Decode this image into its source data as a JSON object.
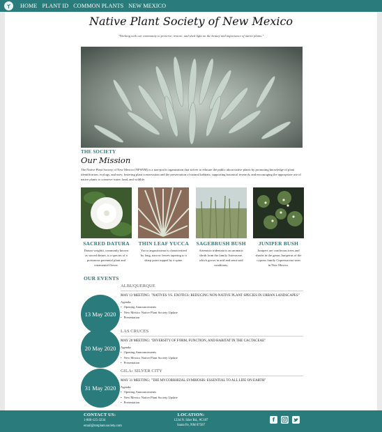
{
  "nav": {
    "items": [
      "HOME",
      "PLANT ID",
      "COMMON PLANTS",
      "NEW MEXICO"
    ]
  },
  "site": {
    "title": "Native Plant Society of New Mexico",
    "tagline": "\"Working with our community to preserve, restore, and shed light on the beauty and importance of native plants.\""
  },
  "society": {
    "kicker": "THE SOCIETY",
    "title": "Our Mission",
    "mission": "The Native Plant Society of New Mexico (NPSNM) is a non-profit organization that strives to educate the public about native plants by promoting knowledge of plant identification, ecology, and uses; fostering plant conservation and the preservation of natural habitats; supporting botanical research; and encouraging the appropriate use of native plants to conserve water, land, and wildlife."
  },
  "plants": [
    {
      "name": "SACRED DATURA",
      "desc": "Datura wrightii, commonly known as sacred datura, is a species of a poisonous perennial plant and ornamental flower."
    },
    {
      "name": "THIN LEAF YUCCA",
      "desc": "Yucca angustissima is characterized by long, narrow leaves tapering to a sharp point topped by a spine."
    },
    {
      "name": "SAGEBRUSH BUSH",
      "desc": "Artemisia tridentata is an aromatic shrub from the family Asteraceae, which grows in arid and semi-arid conditions."
    },
    {
      "name": "JUNIPER BUSH",
      "desc": "Junipers are coniferous trees and shrubs in the genus Juniperus of the cypress family Cupressaceae seen in New Mexico."
    }
  ],
  "events": {
    "title": "OUR EVENTS",
    "list": [
      {
        "date": "13 May 2020",
        "city": "ALBUQUERQUE",
        "headline": "MAY 13 MEETING: \"NATIVES VS. EXOTICS: REDUCING NON-NATIVE PLANT SPECIES IN URBAN LANDSCAPES\"",
        "agenda_label": "Agenda:",
        "items": [
          "Opening Announcements",
          "New Mexico Native Plant Society Update",
          "Presentation"
        ]
      },
      {
        "date": "20 May 2020",
        "city": "LAS CRUCES",
        "headline": "MAY 20 MEETING: \"DIVERSITY OF FORM, FUNCTION, AND HABITAT IN THE CACTACEAE\"",
        "agenda_label": "Agenda:",
        "items": [
          "Opening Announcements",
          "New Mexico Native Plant Society Update",
          "Presentation"
        ]
      },
      {
        "date": "31 May 2020",
        "city": "GILA- SILVER CITY",
        "headline": "MAY 31 MEETING: \"THE MYCORRHIZAL SYMBIOSIS: ESSENTIAL TO ALL LIFE ON EARTH\"",
        "agenda_label": "Agenda:",
        "items": [
          "Opening Announcements",
          "New Mexico Native Plant Society Update",
          "Presentation"
        ]
      }
    ]
  },
  "footer": {
    "contact_title": "CONTACT US:",
    "phone": "1-800-125-3234",
    "email": "email@nmplant.society.com",
    "location_title": "LOCATION:",
    "address1": "1234 N. Siler Rd., #C107",
    "address2": "Santa Fe, NM 87507",
    "social": [
      "facebook-icon",
      "instagram-icon",
      "twitter-icon"
    ]
  },
  "colors": {
    "accent": "#2a7b7b",
    "background": "#e9e9e9"
  }
}
